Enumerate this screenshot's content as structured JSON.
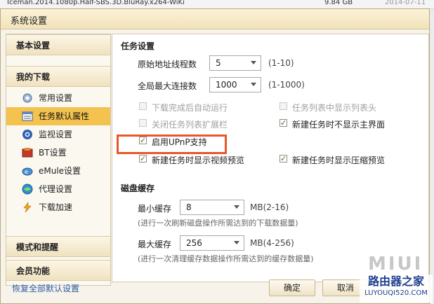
{
  "background_list": {
    "filename": "Iceman.2014.1080p.Half-SBS.3D.BluRay.x264-WiKi",
    "size": "9.84 GB",
    "date": "2014-07-11"
  },
  "dialog": {
    "title": "系统设置"
  },
  "sidebar": {
    "basic_settings": "基本设置",
    "my_downloads": "我的下载",
    "items": [
      {
        "label": "常用设置",
        "icon": "gear-icon"
      },
      {
        "label": "任务默认属性",
        "icon": "list-icon",
        "active": true
      },
      {
        "label": "监视设置",
        "icon": "monitor-icon"
      },
      {
        "label": "BT设置",
        "icon": "bt-icon"
      },
      {
        "label": "eMule设置",
        "icon": "emule-icon"
      },
      {
        "label": "代理设置",
        "icon": "proxy-icon"
      },
      {
        "label": "下载加速",
        "icon": "lightning-icon"
      }
    ],
    "mode_and_reminder": "模式和提醒",
    "member_features": "会员功能",
    "restore_defaults": "恢复全部默认设置"
  },
  "task_settings": {
    "group_title": "任务设置",
    "origin_threads": {
      "label": "原始地址线程数",
      "value": "5",
      "range": "(1-10)"
    },
    "global_max_connections": {
      "label": "全局最大连接数",
      "value": "1000",
      "range": "(1-1000)"
    },
    "checkboxes": {
      "auto_run_after_download": {
        "label": "下载完成后自动运行",
        "checked": false,
        "disabled": true
      },
      "show_list_header": {
        "label": "任务列表中显示列表头",
        "checked": false,
        "disabled": true
      },
      "close_task_list_extension": {
        "label": "关闭任务列表扩展栏",
        "checked": false,
        "disabled": true
      },
      "new_task_hide_main": {
        "label": "新建任务时不显示主界面",
        "checked": true,
        "disabled": false
      },
      "enable_upnp": {
        "label": "启用UPnP支持",
        "checked": true,
        "disabled": false
      },
      "new_task_video_preview": {
        "label": "新建任务时显示视频预览",
        "checked": true,
        "disabled": false
      },
      "new_task_archive_preview": {
        "label": "新建任务时显示压缩预览",
        "checked": true,
        "disabled": false
      }
    }
  },
  "disk_cache": {
    "group_title": "磁盘缓存",
    "min_cache": {
      "label": "最小缓存",
      "value": "8",
      "unit_range": "MB(2-16)",
      "note": "(进行一次刷新磁盘操作所需达到的下载数据量)"
    },
    "max_cache": {
      "label": "最大缓存",
      "value": "256",
      "unit_range": "MB(4-256)",
      "note": "(进行一次清理缓存数据操作所需达到的缓存数据量)"
    }
  },
  "buttons": {
    "ok": "确定",
    "cancel": "取消"
  },
  "watermark": {
    "miui": "MIUI",
    "site_cn": "路由器之家",
    "site_url": "LUYOUQI520.COM"
  },
  "colors": {
    "highlight_box": "#e8572a",
    "active_nav": "#f3c24f",
    "link": "#2a5ba6"
  }
}
